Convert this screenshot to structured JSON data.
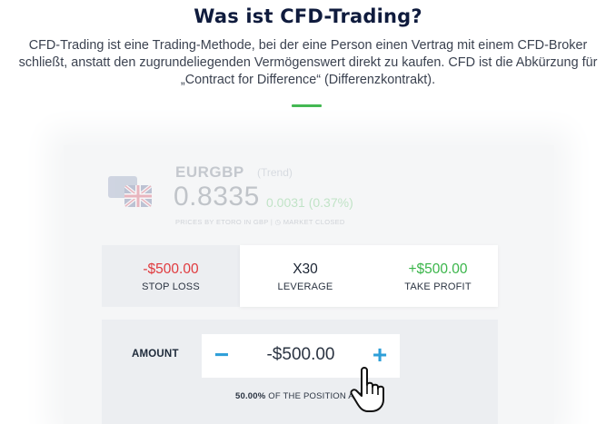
{
  "heading": "Was ist CFD-Trading?",
  "intro": {
    "line1": "CFD-Trading ist eine Trading-Methode, bei der eine Person einen Vertrag mit einem CFD-Broker",
    "line2": "schließt, anstatt den zugrundeliegenden Vermögenswert direkt zu kaufen. CFD ist die Abkürzung für",
    "line3": "„Contract for Difference“ (Differenzkontrakt)."
  },
  "colors": {
    "accent": "#3ab54a",
    "loss": "#e03a3e",
    "stepper": "#2e9fd8",
    "heading": "#0f1b3d"
  },
  "asset": {
    "symbol": "EURGBP",
    "subtitle": "(Trend)",
    "price": "0.8335",
    "change": "0.0031 (0.37%)",
    "meta": "PRICES BY ETORO  IN GBP  |  ◷ MARKET CLOSED",
    "flag_icon": "eu-gb-flag-icon"
  },
  "stop_loss": {
    "value": "-$500.00",
    "label": "STOP LOSS"
  },
  "leverage": {
    "value": "X30",
    "label": "LEVERAGE"
  },
  "take_profit": {
    "value": "+$500.00",
    "label": "TAKE PROFIT"
  },
  "amount": {
    "label": "AMOUNT",
    "value": "-$500.00",
    "minus": "−",
    "plus": "+",
    "percent": "50.00%",
    "percent_text": " OF THE POSITION AMOU"
  },
  "cursor_icon": "hand-pointer-icon"
}
